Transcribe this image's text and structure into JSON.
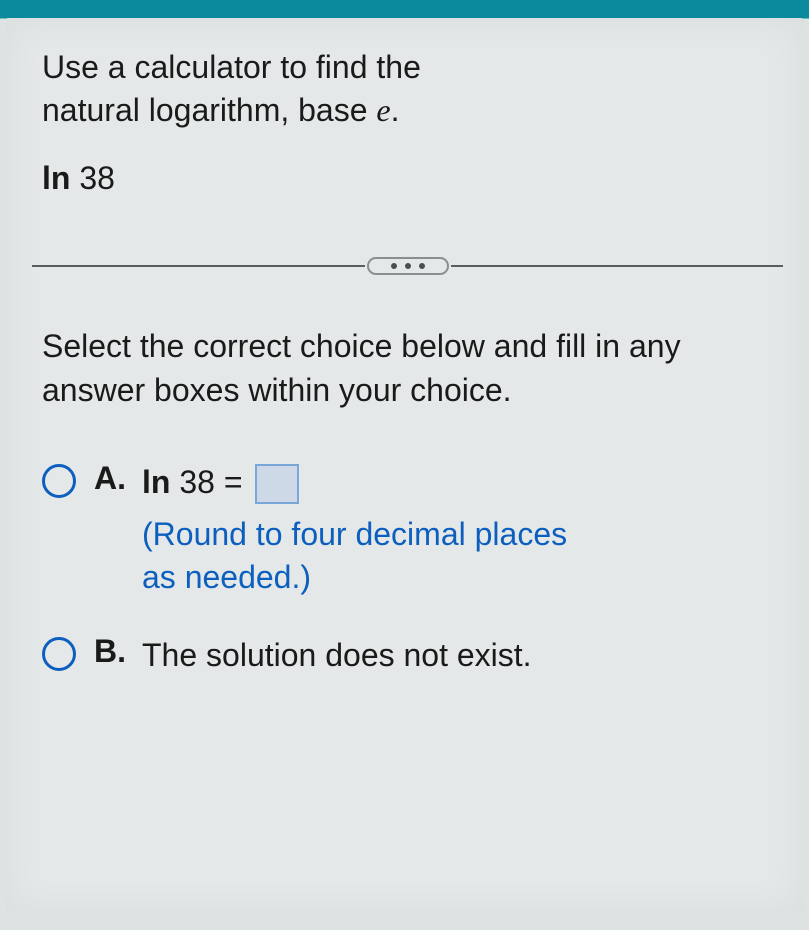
{
  "question": {
    "line1": "Use a calculator to find the",
    "line2_prefix": "natural logarithm, base ",
    "line2_var": "e",
    "line2_suffix": "."
  },
  "expression": {
    "fn": "ln",
    "arg": " 38"
  },
  "instructions": "Select the correct choice below and fill in any answer boxes within your choice.",
  "choices": {
    "a": {
      "letter": "A.",
      "eq_fn": "ln",
      "eq_rest": " 38 = ",
      "note_line1": "(Round to four decimal places",
      "note_line2": "as needed.)"
    },
    "b": {
      "letter": "B.",
      "text": "The solution does not exist."
    }
  }
}
